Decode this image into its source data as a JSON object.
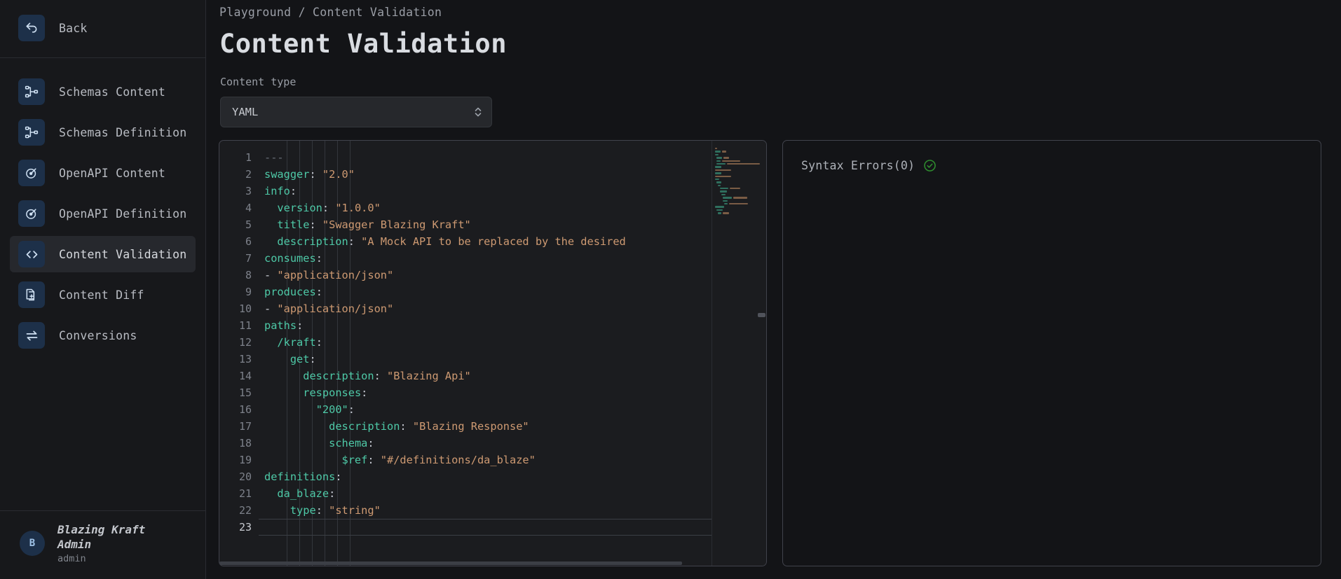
{
  "sidebar": {
    "back": {
      "label": "Back",
      "icon": "back-arrow-icon"
    },
    "items": [
      {
        "label": "Schemas Content",
        "icon": "schema-node-icon",
        "active": false
      },
      {
        "label": "Schemas Definition",
        "icon": "schema-node-icon",
        "active": false
      },
      {
        "label": "OpenAPI Content",
        "icon": "openapi-icon",
        "active": false
      },
      {
        "label": "OpenAPI Definition",
        "icon": "openapi-icon",
        "active": false
      },
      {
        "label": "Content Validation",
        "icon": "code-brackets-icon",
        "active": true
      },
      {
        "label": "Content Diff",
        "icon": "document-diff-icon",
        "active": false
      },
      {
        "label": "Conversions",
        "icon": "swap-arrows-icon",
        "active": false
      }
    ],
    "user": {
      "initial": "B",
      "name": "Blazing Kraft Admin",
      "role": "admin"
    }
  },
  "header": {
    "breadcrumb": "Playground / Content Validation",
    "title": "Content Validation"
  },
  "form": {
    "content_type_label": "Content type",
    "content_type_value": "YAML"
  },
  "editor": {
    "language": "yaml",
    "cursor_line": 23,
    "total_lines": 23,
    "lines": [
      {
        "n": 1,
        "text": "---"
      },
      {
        "n": 2,
        "text": "swagger: \"2.0\""
      },
      {
        "n": 3,
        "text": "info:"
      },
      {
        "n": 4,
        "text": "  version: \"1.0.0\""
      },
      {
        "n": 5,
        "text": "  title: \"Swagger Blazing Kraft\""
      },
      {
        "n": 6,
        "text": "  description: \"A Mock API to be replaced by the desired"
      },
      {
        "n": 7,
        "text": "consumes:"
      },
      {
        "n": 8,
        "text": "- \"application/json\""
      },
      {
        "n": 9,
        "text": "produces:"
      },
      {
        "n": 10,
        "text": "- \"application/json\""
      },
      {
        "n": 11,
        "text": "paths:"
      },
      {
        "n": 12,
        "text": "  /kraft:"
      },
      {
        "n": 13,
        "text": "    get:"
      },
      {
        "n": 14,
        "text": "      description: \"Blazing Api\""
      },
      {
        "n": 15,
        "text": "      responses:"
      },
      {
        "n": 16,
        "text": "        \"200\":"
      },
      {
        "n": 17,
        "text": "          description: \"Blazing Response\""
      },
      {
        "n": 18,
        "text": "          schema:"
      },
      {
        "n": 19,
        "text": "            $ref: \"#/definitions/da_blaze\""
      },
      {
        "n": 20,
        "text": "definitions:"
      },
      {
        "n": 21,
        "text": "  da_blaze:"
      },
      {
        "n": 22,
        "text": "    type: \"string\""
      },
      {
        "n": 23,
        "text": ""
      }
    ]
  },
  "errors": {
    "title": "Syntax Errors(0)",
    "count": 0,
    "status_icon": "check-circle-icon",
    "status_color": "#2e8b2e"
  }
}
